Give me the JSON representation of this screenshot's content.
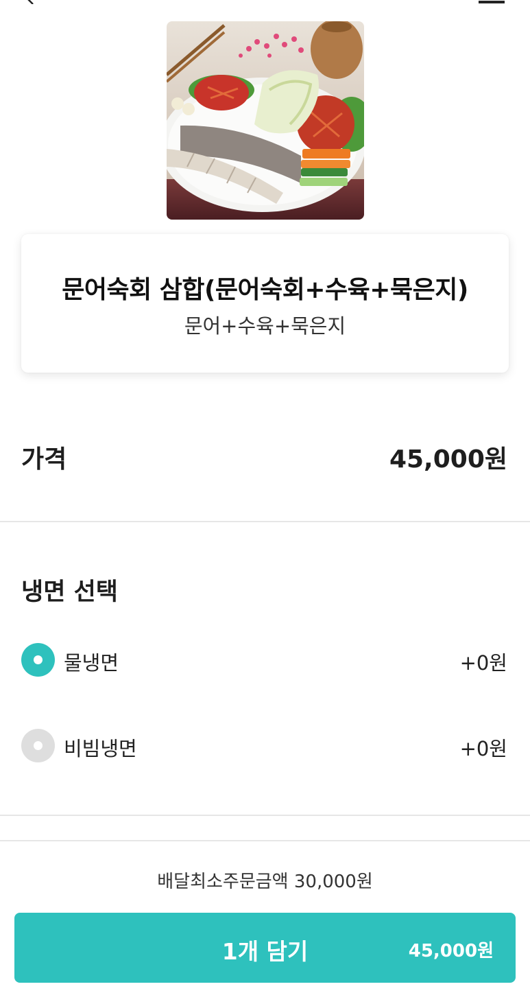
{
  "colors": {
    "accent": "#2ec1bd",
    "divider": "#e6e6e6",
    "radio_off": "#dedede"
  },
  "nav": {
    "back_icon": "chevron-left-icon",
    "menu_icon": "menu-icon"
  },
  "menu": {
    "name": "문어숙회 삼합(문어숙회+수육+묵은지)",
    "description": "문어+수육+묵은지"
  },
  "price": {
    "label": "가격",
    "value": "45,000원"
  },
  "options_group": {
    "title": "냉면 선택",
    "options": [
      {
        "label": "물냉면",
        "price": "+0원",
        "selected": true
      },
      {
        "label": "비빔냉면",
        "price": "+0원",
        "selected": false
      }
    ]
  },
  "footer": {
    "min_order": "배달최소주문금액 30,000원",
    "add_button": {
      "label": "1개 담기",
      "price": "45,000원"
    }
  }
}
